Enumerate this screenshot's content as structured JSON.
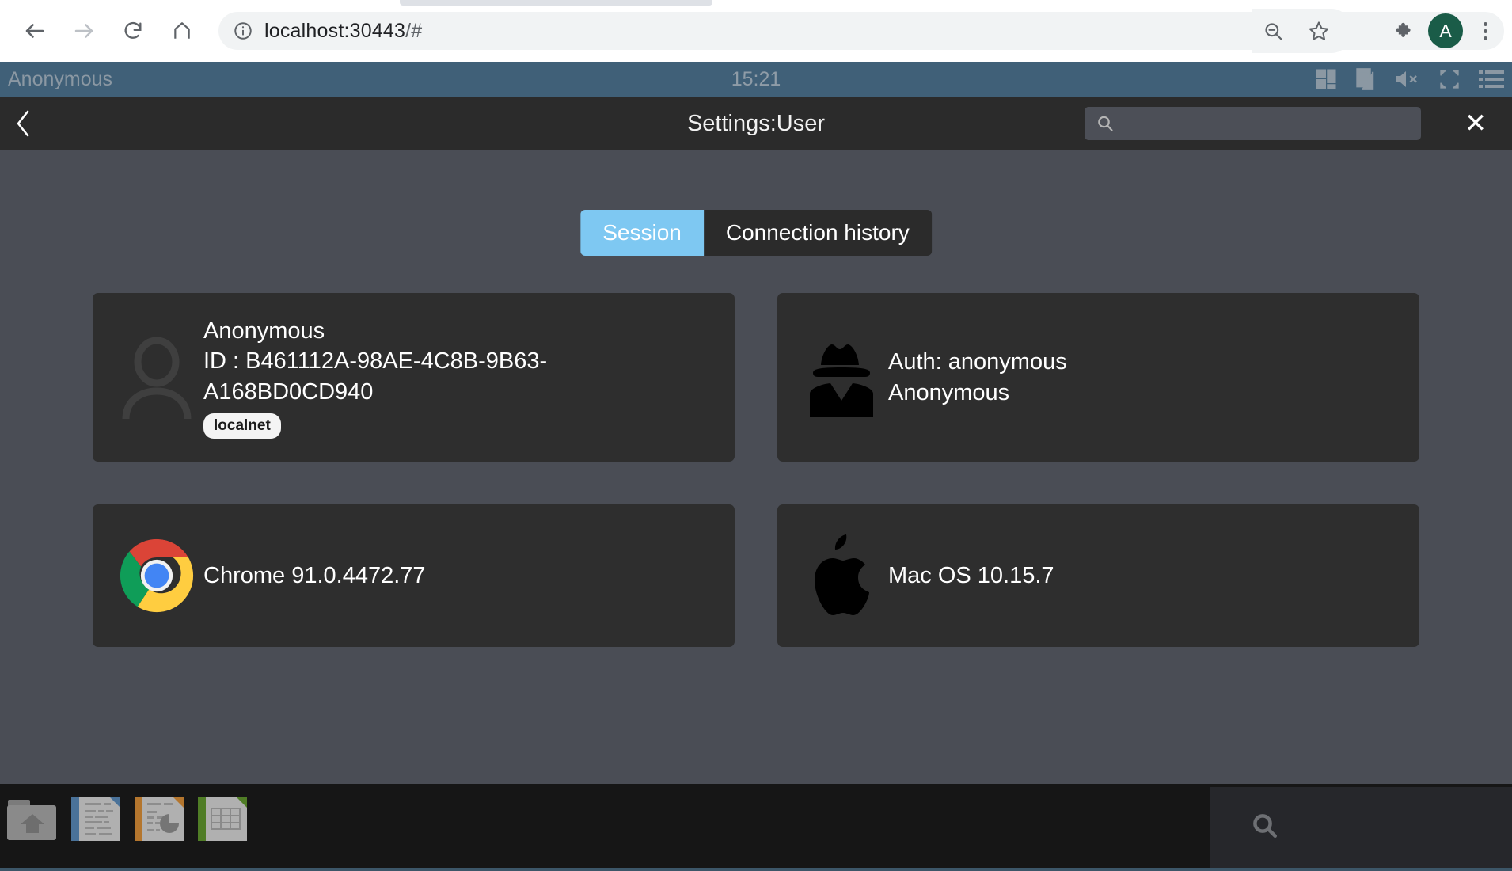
{
  "browser": {
    "url_main": "localhost:30443",
    "url_suffix": "/#",
    "back_icon": "back-arrow-icon",
    "forward_icon": "forward-arrow-icon",
    "reload_icon": "reload-icon",
    "home_icon": "home-icon",
    "info_icon": "site-info-icon",
    "zoom_out_icon": "zoom-out-icon",
    "bookmark_icon": "star-icon",
    "extensions_icon": "puzzle-icon",
    "profile_initial": "A",
    "profile_color": "#1a5c48",
    "menu_icon": "kebab-menu-icon"
  },
  "top_bar": {
    "username": "Anonymous",
    "clock": "15:21",
    "background": "#406078",
    "icons": [
      "layout-grid-icon",
      "clipboard-icon",
      "speaker-mute-icon",
      "fullscreen-icon",
      "menu-list-icon"
    ]
  },
  "settings_header": {
    "back_label": "‹",
    "title": "Settings:User",
    "search_value": "",
    "search_placeholder": "",
    "close_label": "✕",
    "background": "#2b2b2b"
  },
  "tabs": [
    {
      "label": "Session",
      "active": true
    },
    {
      "label": "Connection history",
      "active": false
    }
  ],
  "accent_color": "#7ec8f2",
  "cards": [
    {
      "icon": "user-avatar-icon",
      "name": "Anonymous",
      "id_label": "ID : B461112A-98AE-4C8B-9B63-A168BD0CD940",
      "badge": "localnet"
    },
    {
      "icon": "incognito-spy-icon",
      "line1": "Auth: anonymous",
      "line2": "Anonymous"
    },
    {
      "icon": "chrome-logo-icon",
      "line1": "Chrome 91.0.4472.77"
    },
    {
      "icon": "apple-logo-icon",
      "line1": "Mac OS 10.15.7"
    }
  ],
  "taskbar": {
    "items": [
      {
        "name": "home-folder-icon"
      },
      {
        "name": "document-writer-icon"
      },
      {
        "name": "presentation-impress-icon"
      },
      {
        "name": "spreadsheet-calc-icon"
      }
    ],
    "search_icon": "search-icon",
    "background": "#161616"
  }
}
